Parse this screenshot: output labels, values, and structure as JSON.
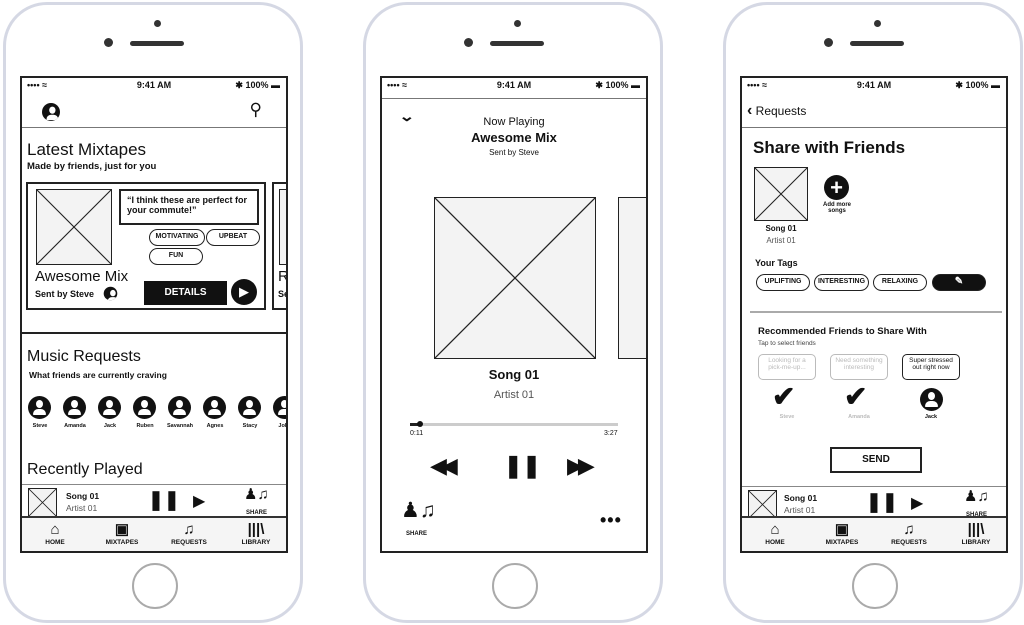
{
  "status": {
    "time": "9:41 AM",
    "battery": "100%",
    "signal": "•••• ≈",
    "bt": "✱"
  },
  "tabs": [
    {
      "label": "HOME",
      "icon": "home-icon",
      "glyph": "⌂"
    },
    {
      "label": "MIXTAPES",
      "icon": "cassette-icon",
      "glyph": "▣"
    },
    {
      "label": "REQUESTS",
      "icon": "chat-music-icon",
      "glyph": "♫"
    },
    {
      "label": "LIBRARY",
      "icon": "library-icon",
      "glyph": "|||\\"
    }
  ],
  "mini_player": {
    "song": "Song 01",
    "artist": "Artist 01",
    "share": "SHARE"
  },
  "home": {
    "title": "Latest Mixtapes",
    "subtitle": "Made by friends, just for you",
    "card": {
      "quote": "“I think these are perfect for your commute!”",
      "tags": [
        "MOTIVATING",
        "UPBEAT",
        "FUN"
      ],
      "name": "Awesome Mix",
      "sender": "Sent by Steve",
      "details": "DETAILS",
      "peek_name": "R",
      "peek_sender": "Se"
    },
    "requests_title": "Music Requests",
    "requests_subtitle": "What friends are currently craving",
    "friends": [
      "Steve",
      "Amanda",
      "Jack",
      "Ruben",
      "Savannah",
      "Agnes",
      "Stacy",
      "John"
    ],
    "recent_title": "Recently Played"
  },
  "now_playing": {
    "label": "Now Playing",
    "title": "Awesome Mix",
    "sender": "Sent by Steve",
    "song": "Song 01",
    "artist": "Artist 01",
    "elapsed": "0:11",
    "duration": "3:27",
    "progress": 0.05,
    "share": "SHARE"
  },
  "share": {
    "back": "Requests",
    "title": "Share with Friends",
    "song": "Song 01",
    "artist": "Artist 01",
    "add_more": "Add more songs",
    "tags_title": "Your Tags",
    "tags": [
      "UPLIFTING",
      "INTERESTING",
      "RELAXING"
    ],
    "rec_title": "Recommended Friends to Share With",
    "rec_subtitle": "Tap to select friends",
    "friends": [
      {
        "name": "Steve",
        "bubble": "Looking for a pick-me-up...",
        "selected": true
      },
      {
        "name": "Amanda",
        "bubble": "Need something interesting",
        "selected": true
      },
      {
        "name": "Jack",
        "bubble": "Super stressed out right now",
        "selected": false
      }
    ],
    "send": "SEND"
  }
}
